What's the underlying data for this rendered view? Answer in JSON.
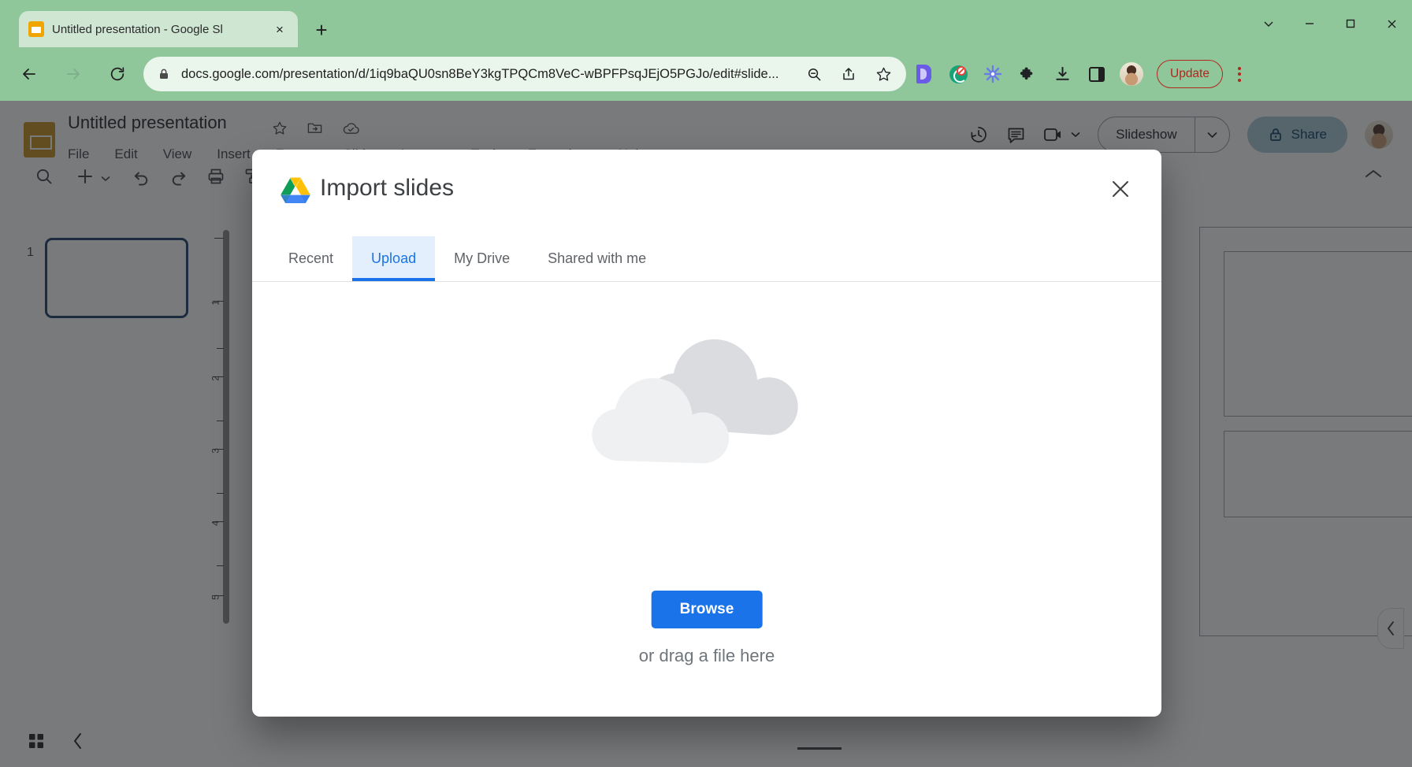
{
  "browser": {
    "tab": {
      "title": "Untitled presentation - Google Sl",
      "favicon": "slides-favicon",
      "close": "×"
    },
    "new_tab": "+",
    "window_controls": {
      "minimize_extra": "⌄",
      "minimize": "—",
      "maximize": "▢",
      "close": "✕"
    },
    "nav": {
      "back": "back-arrow",
      "forward": "forward-arrow",
      "reload": "reload-arrow"
    },
    "omnibox": {
      "lock": "lock-icon",
      "url_main": "docs.google.com/presentation/d/1iq9baQU0sn8BeY3kgTPQCm8VeC-wBPFPsqJEjO5PGJo/edit#slide...",
      "zoom_out": "zoom-out-icon",
      "share": "share-icon",
      "bookmark": "star-icon"
    },
    "extensions": [
      {
        "name": "docs-offline-extension",
        "label": "D"
      },
      {
        "name": "grammarly-extension",
        "label": "G"
      },
      {
        "name": "asterisk-extension",
        "label": "✳"
      },
      {
        "name": "extensions-puzzle",
        "label": "puzzle"
      },
      {
        "name": "downloads",
        "label": "download"
      },
      {
        "name": "side-panel",
        "label": "panel"
      }
    ],
    "update_button": "Update",
    "profile": "user-avatar"
  },
  "slides": {
    "logo": "google-slides-logo",
    "doc_title": "Untitled presentation",
    "title_icons": [
      {
        "name": "star-icon",
        "label": "☆"
      },
      {
        "name": "move-to-folder-icon",
        "label": "folder"
      },
      {
        "name": "drive-sync-icon",
        "label": "cloud"
      }
    ],
    "menu": [
      "File",
      "Edit",
      "View",
      "Insert",
      "Format",
      "Slide",
      "Arrange",
      "Tools",
      "Extensions",
      "Help"
    ],
    "header_right": {
      "version_history": "version-history-icon",
      "comments": "comment-icon",
      "meet": "meet-camera-icon",
      "slideshow": "Slideshow",
      "share": "Share"
    },
    "filmstrip": {
      "slide_number": "1"
    },
    "ruler_labels_v": [
      "1",
      "2",
      "3",
      "4",
      "5"
    ]
  },
  "modal": {
    "logo": "google-drive-logo",
    "title": "Import slides",
    "close": "✕",
    "tabs": [
      {
        "label": "Recent",
        "active": false
      },
      {
        "label": "Upload",
        "active": true
      },
      {
        "label": "My Drive",
        "active": false
      },
      {
        "label": "Shared with me",
        "active": false
      }
    ],
    "illustration": "upload-cloud-illustration",
    "browse_button": "Browse",
    "drag_text": "or drag a file here"
  },
  "colors": {
    "browser_green": "#8fc79b",
    "tab_bg": "#cfe6d3",
    "omnibox_bg": "#eaf5ec",
    "update_red": "#b3261e",
    "accent_blue": "#1a73e8",
    "tab_active_bg": "#e3effd",
    "scrim": "rgba(32,33,36,0.60)",
    "cloud_back": "#dadce0",
    "cloud_front": "#eef0f2",
    "slides_orange": "#c5901a",
    "slide_select": "#1b3a6b"
  }
}
